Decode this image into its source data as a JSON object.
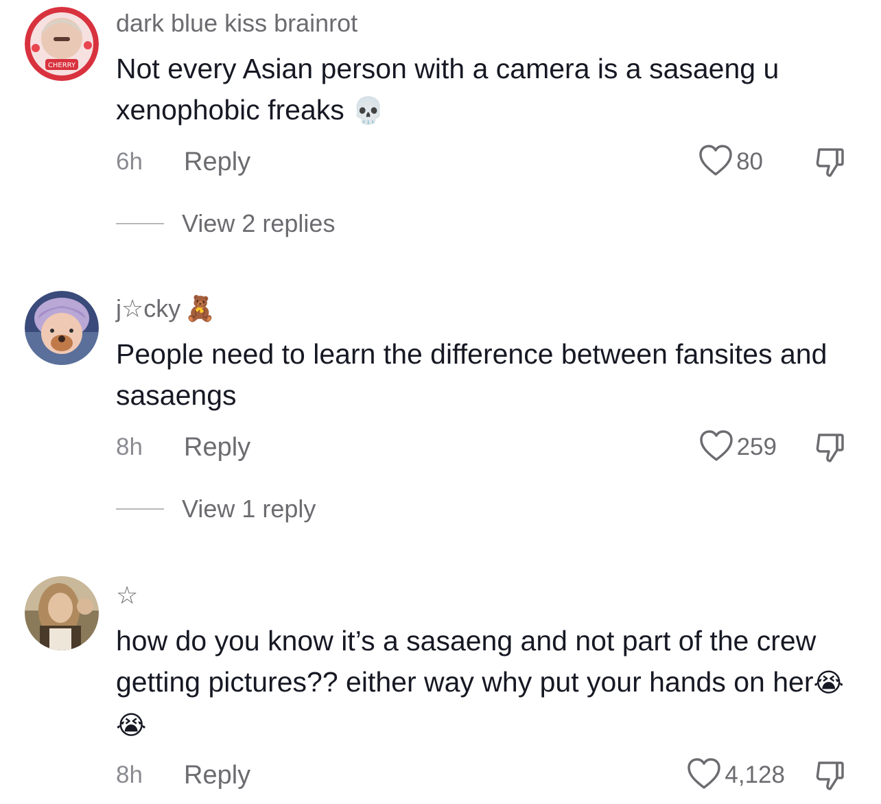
{
  "comments": [
    {
      "username": "dark blue kiss brainrot",
      "username_emoji": "",
      "text": "Not every Asian person with a camera is a sasaeng u xenophobic freaks",
      "text_emoji": "💀",
      "time": "6h",
      "reply_label": "Reply",
      "likes": "80",
      "view_replies": "View 2 replies",
      "avatar_badge": "CHERRY"
    },
    {
      "username": "j☆cky",
      "username_emoji": "🧸",
      "text": "People need to learn the difference between fansites and sasaengs",
      "text_emoji": "",
      "time": "8h",
      "reply_label": "Reply",
      "likes": "259",
      "view_replies": "View 1 reply"
    },
    {
      "username": "☆",
      "username_emoji": "",
      "text": "how do you know it’s a sasaeng and not part of the crew getting pictures?? either way why put your hands on her",
      "text_emoji": "😭 😭",
      "time": "8h",
      "reply_label": "Reply",
      "likes": "4,128"
    }
  ],
  "colors": {
    "text_primary": "#161823",
    "text_secondary": "#6b6b70",
    "text_muted": "#8a8b91",
    "background": "#ffffff"
  },
  "icons": {
    "like": "heart-outline-icon",
    "dislike": "thumbs-down-icon"
  }
}
